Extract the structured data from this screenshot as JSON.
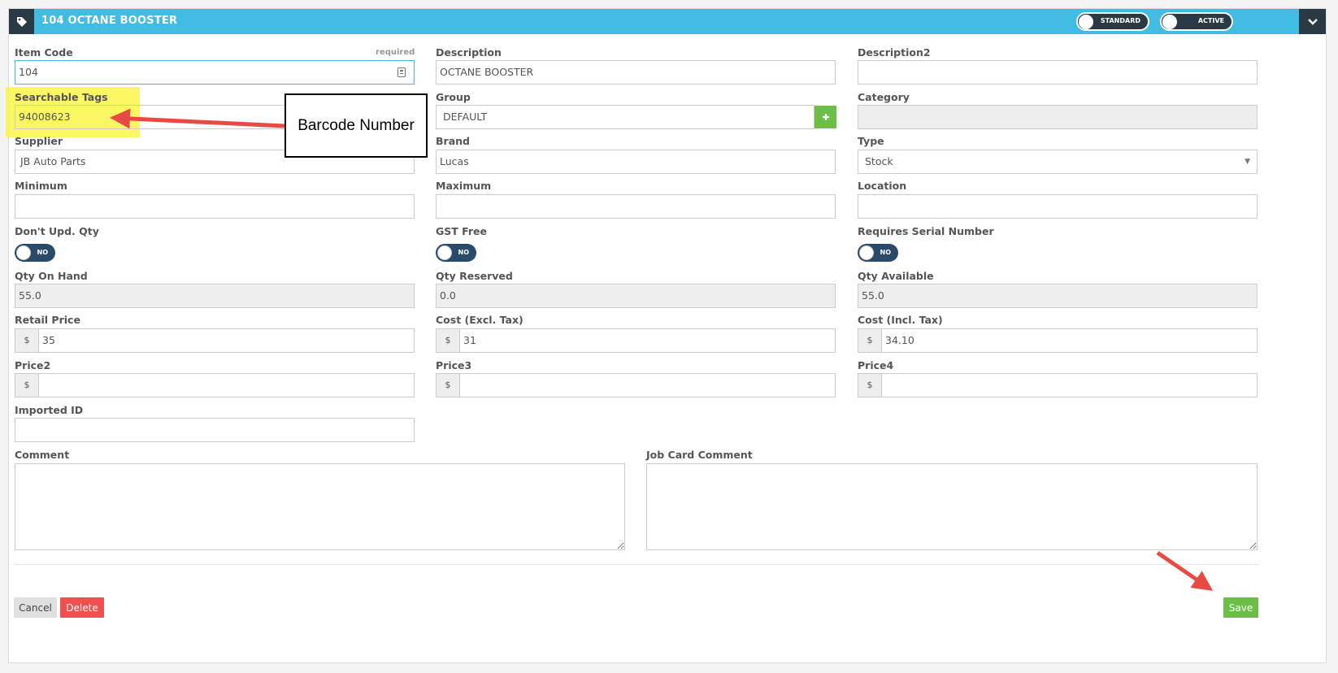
{
  "header": {
    "title": "104 OCTANE BOOSTER",
    "toggle_standard": "STANDARD",
    "toggle_active": "ACTIVE"
  },
  "fields": {
    "item_code": {
      "label": "Item Code",
      "hint": "required",
      "value": "104"
    },
    "description": {
      "label": "Description",
      "value": "OCTANE BOOSTER"
    },
    "description2": {
      "label": "Description2",
      "value": ""
    },
    "searchable_tags": {
      "label": "Searchable Tags",
      "value": "94008623"
    },
    "group": {
      "label": "Group",
      "value": "DEFAULT"
    },
    "category": {
      "label": "Category",
      "value": ""
    },
    "supplier": {
      "label": "Supplier",
      "value": "JB Auto Parts"
    },
    "brand": {
      "label": "Brand",
      "value": "Lucas"
    },
    "type": {
      "label": "Type",
      "value": "Stock"
    },
    "minimum": {
      "label": "Minimum",
      "value": ""
    },
    "maximum": {
      "label": "Maximum",
      "value": ""
    },
    "location": {
      "label": "Location",
      "value": ""
    },
    "dont_upd_qty": {
      "label": "Don't Upd. Qty",
      "toggle": "NO"
    },
    "gst_free": {
      "label": "GST Free",
      "toggle": "NO"
    },
    "requires_serial": {
      "label": "Requires Serial Number",
      "toggle": "NO"
    },
    "qty_on_hand": {
      "label": "Qty On Hand",
      "value": "55.0"
    },
    "qty_reserved": {
      "label": "Qty Reserved",
      "value": "0.0"
    },
    "qty_available": {
      "label": "Qty Available",
      "value": "55.0"
    },
    "retail_price": {
      "label": "Retail Price",
      "prefix": "$",
      "value": "35"
    },
    "cost_excl": {
      "label": "Cost (Excl. Tax)",
      "prefix": "$",
      "value": "31"
    },
    "cost_incl": {
      "label": "Cost (Incl. Tax)",
      "prefix": "$",
      "value": "34.10"
    },
    "price2": {
      "label": "Price2",
      "prefix": "$",
      "value": ""
    },
    "price3": {
      "label": "Price3",
      "prefix": "$",
      "value": ""
    },
    "price4": {
      "label": "Price4",
      "prefix": "$",
      "value": ""
    },
    "imported_id": {
      "label": "Imported ID",
      "value": ""
    },
    "comment": {
      "label": "Comment",
      "value": ""
    },
    "job_card_comment": {
      "label": "Job Card Comment",
      "value": ""
    }
  },
  "buttons": {
    "cancel": "Cancel",
    "delete": "Delete",
    "save": "Save"
  },
  "annotation": {
    "callout_text": "Barcode Number"
  },
  "colors": {
    "header_bg": "#41bce3",
    "dark": "#2a3a45",
    "save": "#6cbf45",
    "delete": "#f0504f",
    "highlight": "#faf53c",
    "arrow": "#ea4a44"
  },
  "icons": [
    "tag-icon",
    "chevron-down-icon",
    "id-card-icon",
    "plus-icon",
    "caret-down-icon",
    "resize-grip-icon"
  ]
}
